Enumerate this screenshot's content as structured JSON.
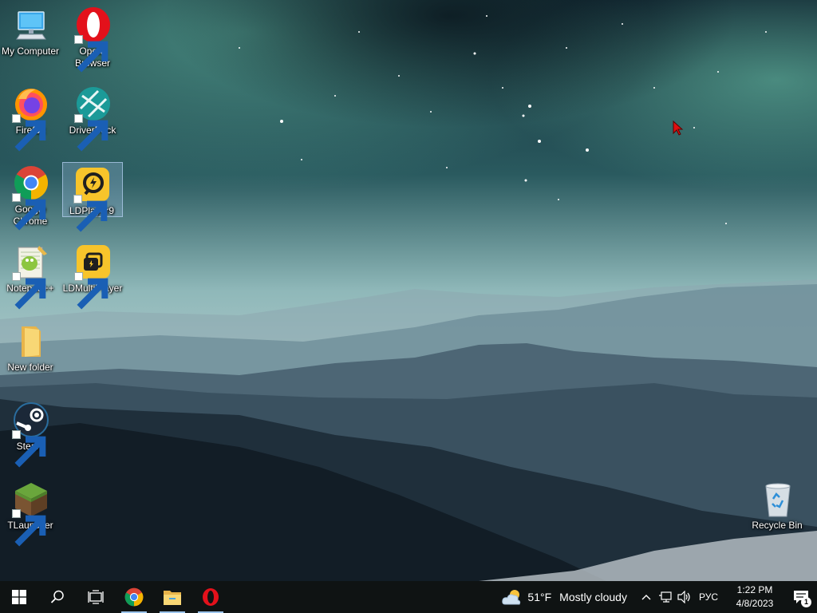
{
  "desktop": {
    "icons": [
      {
        "label": "My Computer",
        "icon": "computer-icon",
        "shortcut": false,
        "selected": false
      },
      {
        "label": "Opera\nBrowser",
        "icon": "opera-icon",
        "shortcut": true,
        "selected": false
      },
      {
        "label": "Firefox",
        "icon": "firefox-icon",
        "shortcut": true,
        "selected": false
      },
      {
        "label": "DriverPack",
        "icon": "driverpack-icon",
        "shortcut": true,
        "selected": false
      },
      {
        "label": "Google\nChrome",
        "icon": "chrome-icon",
        "shortcut": true,
        "selected": false
      },
      {
        "label": "LDPlayer9",
        "icon": "ldplayer-icon",
        "shortcut": true,
        "selected": true
      },
      {
        "label": "Notepad++",
        "icon": "notepadpp-icon",
        "shortcut": true,
        "selected": false
      },
      {
        "label": "LDMultiPlayer",
        "icon": "ldmultiplayer-icon",
        "shortcut": true,
        "selected": false
      },
      {
        "label": "New folder",
        "icon": "folder-icon",
        "shortcut": false,
        "selected": false
      },
      {
        "label": "Steam",
        "icon": "steam-icon",
        "shortcut": true,
        "selected": false
      },
      {
        "label": "TLauncher",
        "icon": "tlauncher-icon",
        "shortcut": true,
        "selected": false
      },
      {
        "label": "Recycle Bin",
        "icon": "recycle-bin-icon",
        "shortcut": false,
        "selected": false
      }
    ]
  },
  "taskbar": {
    "start": "windows-logo-icon",
    "search": "search-icon",
    "task_view": "task-view-icon",
    "pinned": [
      {
        "name": "Google Chrome",
        "icon": "chrome-icon"
      },
      {
        "name": "File Explorer",
        "icon": "file-explorer-icon"
      },
      {
        "name": "Opera",
        "icon": "opera-icon"
      }
    ]
  },
  "tray": {
    "weather": {
      "temperature": "51°F",
      "condition": "Mostly cloudy",
      "icon": "partly-cloudy-icon"
    },
    "language": "РУС",
    "time": "1:22 PM",
    "date": "4/8/2023",
    "notification_count": "1"
  },
  "colors": {
    "taskbar_bg": "#0f1313",
    "taskbar_indicator": "#9cc4ec",
    "aurora": "#5fbfa8",
    "sky": "#0e2230"
  }
}
